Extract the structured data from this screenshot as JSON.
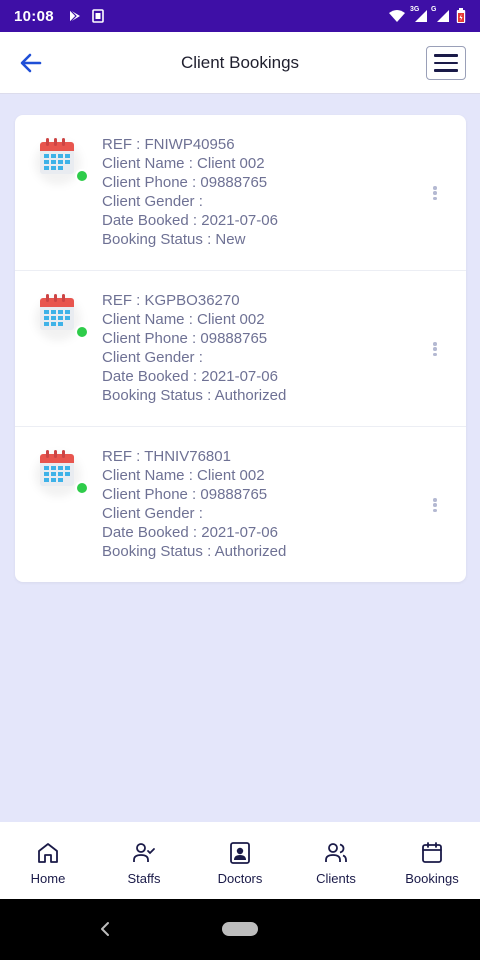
{
  "status_bar": {
    "time": "10:08",
    "icons": [
      "play-store-icon",
      "sim-card-icon",
      "wifi-icon",
      "cell-signal-3g-icon",
      "cell-signal-g-icon",
      "battery-icon"
    ],
    "network_3g": "3G",
    "network_g": "G"
  },
  "header": {
    "title": "Client Bookings",
    "back_icon": "arrow-left-icon",
    "menu_icon": "hamburger-menu-icon"
  },
  "bookings": [
    {
      "ref": "REF : FNIWP40956",
      "client_name": "Client Name : Client 002",
      "client_phone": "Client Phone : 09888765",
      "client_gender": "Client Gender :",
      "date_booked": "Date Booked : 2021-07-06",
      "booking_status": "Booking Status : New"
    },
    {
      "ref": "REF : KGPBO36270",
      "client_name": "Client Name : Client 002",
      "client_phone": "Client Phone : 09888765",
      "client_gender": "Client Gender :",
      "date_booked": "Date Booked : 2021-07-06",
      "booking_status": "Booking Status : Authorized"
    },
    {
      "ref": "REF : THNIV76801",
      "client_name": "Client Name : Client 002",
      "client_phone": "Client Phone : 09888765",
      "client_gender": "Client Gender :",
      "date_booked": "Date Booked : 2021-07-06",
      "booking_status": "Booking Status : Authorized"
    }
  ],
  "bottom_nav": {
    "items": [
      {
        "label": "Home",
        "icon": "home-icon"
      },
      {
        "label": "Staffs",
        "icon": "user-check-icon"
      },
      {
        "label": "Doctors",
        "icon": "doctor-badge-icon"
      },
      {
        "label": "Clients",
        "icon": "users-icon"
      },
      {
        "label": "Bookings",
        "icon": "calendar-icon"
      }
    ]
  },
  "colors": {
    "status_bar": "#3e0fa6",
    "background": "#e4e6fa",
    "accent": "#1f4fd6",
    "text_secondary": "#6e7194",
    "nav_text": "#1a1a48",
    "online_indicator": "#2ecc4a"
  }
}
